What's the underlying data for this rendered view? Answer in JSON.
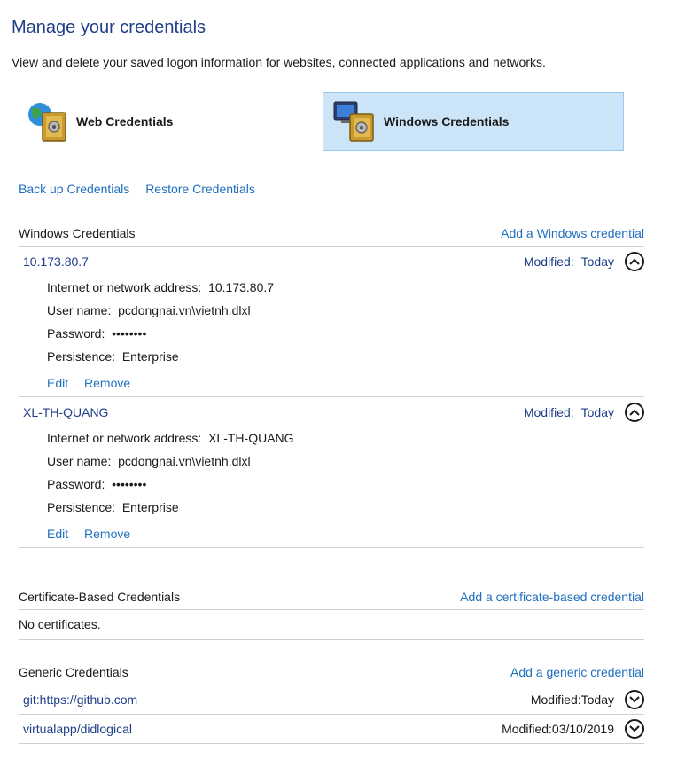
{
  "header": {
    "title": "Manage your credentials",
    "description": "View and delete your saved logon information for websites, connected applications and networks."
  },
  "tabs": {
    "web": {
      "label": "Web Credentials",
      "icon": "globe-vault-icon"
    },
    "windows": {
      "label": "Windows Credentials",
      "icon": "computer-vault-icon",
      "selected": true
    }
  },
  "links": {
    "backup": "Back up Credentials",
    "restore": "Restore Credentials"
  },
  "windows_section": {
    "title": "Windows Credentials",
    "add_label": "Add a Windows credential",
    "items": [
      {
        "name": "10.173.80.7",
        "modified_label": "Modified:",
        "modified_value": "Today",
        "address_label": "Internet or network address:",
        "address_value": "10.173.80.7",
        "user_label": "User name:",
        "user_value": "pcdongnai.vn\\vietnh.dlxl",
        "password_label": "Password:",
        "password_value": "••••••••",
        "persistence_label": "Persistence:",
        "persistence_value": "Enterprise",
        "edit": "Edit",
        "remove": "Remove"
      },
      {
        "name": "XL-TH-QUANG",
        "modified_label": "Modified:",
        "modified_value": "Today",
        "address_label": "Internet or network address:",
        "address_value": "XL-TH-QUANG",
        "user_label": "User name:",
        "user_value": "pcdongnai.vn\\vietnh.dlxl",
        "password_label": "Password:",
        "password_value": "••••••••",
        "persistence_label": "Persistence:",
        "persistence_value": "Enterprise",
        "edit": "Edit",
        "remove": "Remove"
      }
    ]
  },
  "certificate_section": {
    "title": "Certificate-Based Credentials",
    "add_label": "Add a certificate-based credential",
    "empty_text": "No certificates."
  },
  "generic_section": {
    "title": "Generic Credentials",
    "add_label": "Add a generic credential",
    "items": [
      {
        "name": "git:https://github.com",
        "modified_label": "Modified:",
        "modified_value": "Today"
      },
      {
        "name": "virtualapp/didlogical",
        "modified_label": "Modified:",
        "modified_value": "03/10/2019"
      }
    ]
  },
  "colors": {
    "accent": "#1f6fbf",
    "title": "#1e3e8a",
    "selected_bg": "#cce4f7",
    "selected_border": "#99c9ef"
  }
}
